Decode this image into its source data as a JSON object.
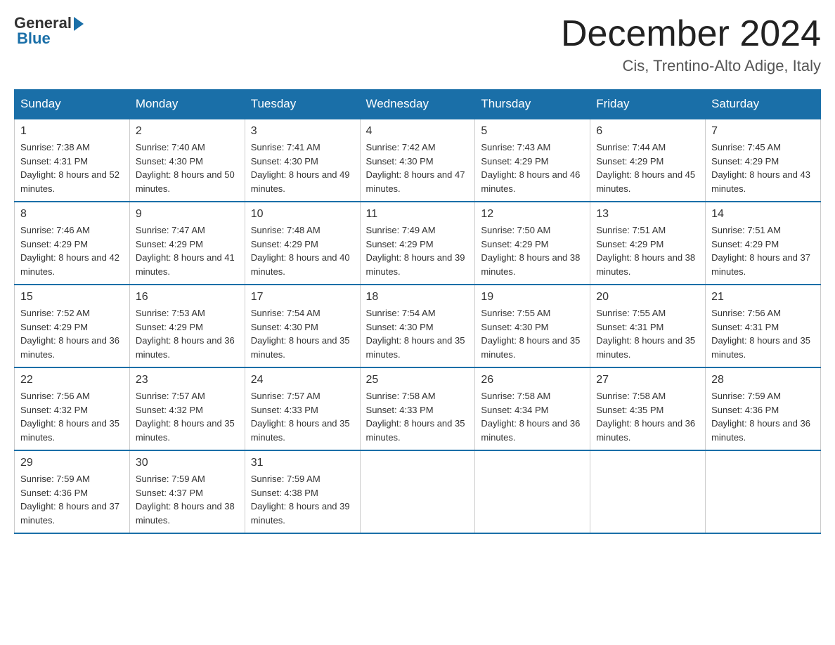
{
  "header": {
    "logo_general": "General",
    "logo_blue": "Blue",
    "month_title": "December 2024",
    "location": "Cis, Trentino-Alto Adige, Italy"
  },
  "weekdays": [
    "Sunday",
    "Monday",
    "Tuesday",
    "Wednesday",
    "Thursday",
    "Friday",
    "Saturday"
  ],
  "weeks": [
    [
      {
        "day": "1",
        "sunrise": "7:38 AM",
        "sunset": "4:31 PM",
        "daylight": "8 hours and 52 minutes."
      },
      {
        "day": "2",
        "sunrise": "7:40 AM",
        "sunset": "4:30 PM",
        "daylight": "8 hours and 50 minutes."
      },
      {
        "day": "3",
        "sunrise": "7:41 AM",
        "sunset": "4:30 PM",
        "daylight": "8 hours and 49 minutes."
      },
      {
        "day": "4",
        "sunrise": "7:42 AM",
        "sunset": "4:30 PM",
        "daylight": "8 hours and 47 minutes."
      },
      {
        "day": "5",
        "sunrise": "7:43 AM",
        "sunset": "4:29 PM",
        "daylight": "8 hours and 46 minutes."
      },
      {
        "day": "6",
        "sunrise": "7:44 AM",
        "sunset": "4:29 PM",
        "daylight": "8 hours and 45 minutes."
      },
      {
        "day": "7",
        "sunrise": "7:45 AM",
        "sunset": "4:29 PM",
        "daylight": "8 hours and 43 minutes."
      }
    ],
    [
      {
        "day": "8",
        "sunrise": "7:46 AM",
        "sunset": "4:29 PM",
        "daylight": "8 hours and 42 minutes."
      },
      {
        "day": "9",
        "sunrise": "7:47 AM",
        "sunset": "4:29 PM",
        "daylight": "8 hours and 41 minutes."
      },
      {
        "day": "10",
        "sunrise": "7:48 AM",
        "sunset": "4:29 PM",
        "daylight": "8 hours and 40 minutes."
      },
      {
        "day": "11",
        "sunrise": "7:49 AM",
        "sunset": "4:29 PM",
        "daylight": "8 hours and 39 minutes."
      },
      {
        "day": "12",
        "sunrise": "7:50 AM",
        "sunset": "4:29 PM",
        "daylight": "8 hours and 38 minutes."
      },
      {
        "day": "13",
        "sunrise": "7:51 AM",
        "sunset": "4:29 PM",
        "daylight": "8 hours and 38 minutes."
      },
      {
        "day": "14",
        "sunrise": "7:51 AM",
        "sunset": "4:29 PM",
        "daylight": "8 hours and 37 minutes."
      }
    ],
    [
      {
        "day": "15",
        "sunrise": "7:52 AM",
        "sunset": "4:29 PM",
        "daylight": "8 hours and 36 minutes."
      },
      {
        "day": "16",
        "sunrise": "7:53 AM",
        "sunset": "4:29 PM",
        "daylight": "8 hours and 36 minutes."
      },
      {
        "day": "17",
        "sunrise": "7:54 AM",
        "sunset": "4:30 PM",
        "daylight": "8 hours and 35 minutes."
      },
      {
        "day": "18",
        "sunrise": "7:54 AM",
        "sunset": "4:30 PM",
        "daylight": "8 hours and 35 minutes."
      },
      {
        "day": "19",
        "sunrise": "7:55 AM",
        "sunset": "4:30 PM",
        "daylight": "8 hours and 35 minutes."
      },
      {
        "day": "20",
        "sunrise": "7:55 AM",
        "sunset": "4:31 PM",
        "daylight": "8 hours and 35 minutes."
      },
      {
        "day": "21",
        "sunrise": "7:56 AM",
        "sunset": "4:31 PM",
        "daylight": "8 hours and 35 minutes."
      }
    ],
    [
      {
        "day": "22",
        "sunrise": "7:56 AM",
        "sunset": "4:32 PM",
        "daylight": "8 hours and 35 minutes."
      },
      {
        "day": "23",
        "sunrise": "7:57 AM",
        "sunset": "4:32 PM",
        "daylight": "8 hours and 35 minutes."
      },
      {
        "day": "24",
        "sunrise": "7:57 AM",
        "sunset": "4:33 PM",
        "daylight": "8 hours and 35 minutes."
      },
      {
        "day": "25",
        "sunrise": "7:58 AM",
        "sunset": "4:33 PM",
        "daylight": "8 hours and 35 minutes."
      },
      {
        "day": "26",
        "sunrise": "7:58 AM",
        "sunset": "4:34 PM",
        "daylight": "8 hours and 36 minutes."
      },
      {
        "day": "27",
        "sunrise": "7:58 AM",
        "sunset": "4:35 PM",
        "daylight": "8 hours and 36 minutes."
      },
      {
        "day": "28",
        "sunrise": "7:59 AM",
        "sunset": "4:36 PM",
        "daylight": "8 hours and 36 minutes."
      }
    ],
    [
      {
        "day": "29",
        "sunrise": "7:59 AM",
        "sunset": "4:36 PM",
        "daylight": "8 hours and 37 minutes."
      },
      {
        "day": "30",
        "sunrise": "7:59 AM",
        "sunset": "4:37 PM",
        "daylight": "8 hours and 38 minutes."
      },
      {
        "day": "31",
        "sunrise": "7:59 AM",
        "sunset": "4:38 PM",
        "daylight": "8 hours and 39 minutes."
      },
      null,
      null,
      null,
      null
    ]
  ]
}
